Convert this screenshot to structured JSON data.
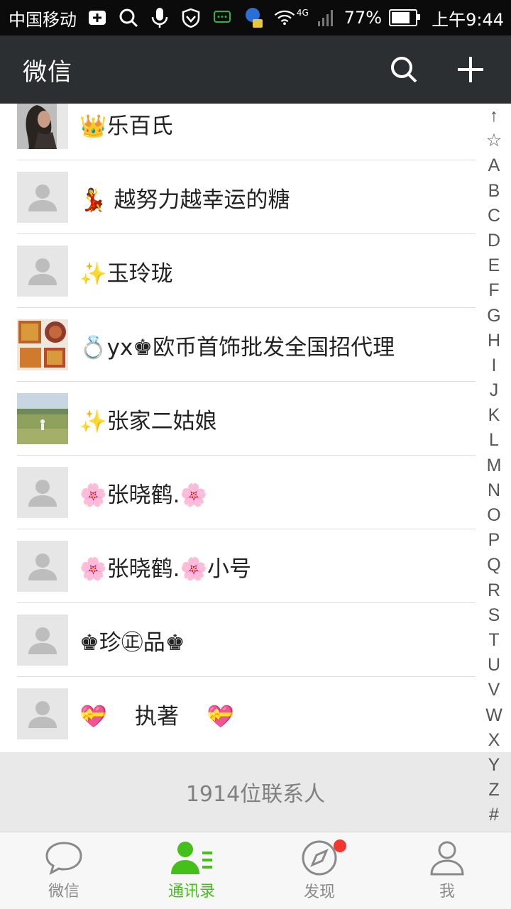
{
  "status_bar": {
    "carrier": "中国移动",
    "network": "4G",
    "battery": "77%",
    "battery_level": 0.77,
    "time": "上午9:44",
    "icons": [
      "plus-box-icon",
      "search-icon",
      "mic-icon",
      "shield-icon",
      "chat-bubble-icon",
      "contact-icon",
      "wifi-icon",
      "signal-icon"
    ]
  },
  "header": {
    "title": "微信",
    "search_icon": "search-icon",
    "add_icon": "plus-icon"
  },
  "contacts": [
    {
      "name": "👑乐百氏",
      "avatar": "photo-woman"
    },
    {
      "name": "💃 越努力越幸运的糖",
      "avatar": "default"
    },
    {
      "name": "✨玉玲珑",
      "avatar": "default"
    },
    {
      "name": "💍yx♚欧币首饰批发全国招代理",
      "avatar": "photo-jewelry"
    },
    {
      "name": "✨张家二姑娘",
      "avatar": "photo-landscape"
    },
    {
      "name": "🌸张晓鹤.🌸",
      "avatar": "default"
    },
    {
      "name": "🌸张晓鹤.🌸小号",
      "avatar": "default"
    },
    {
      "name": "♚珍㊣品♚",
      "avatar": "default"
    },
    {
      "name": "💝    执著    💝",
      "avatar": "default"
    }
  ],
  "index_letters": [
    "↑",
    "☆",
    "A",
    "B",
    "C",
    "D",
    "E",
    "F",
    "G",
    "H",
    "I",
    "J",
    "K",
    "L",
    "M",
    "N",
    "O",
    "P",
    "Q",
    "R",
    "S",
    "T",
    "U",
    "V",
    "W",
    "X",
    "Y",
    "Z",
    "#"
  ],
  "footer": {
    "contact_count": "1914位联系人"
  },
  "bottom_nav": [
    {
      "label": "微信",
      "icon": "chat-icon",
      "active": false
    },
    {
      "label": "通讯录",
      "icon": "contacts-icon",
      "active": true
    },
    {
      "label": "发现",
      "icon": "compass-icon",
      "active": false,
      "badge": true
    },
    {
      "label": "我",
      "icon": "person-icon",
      "active": false
    }
  ],
  "colors": {
    "accent": "#45c01a",
    "header_bg": "#2b2f31",
    "badge": "#f43530"
  }
}
